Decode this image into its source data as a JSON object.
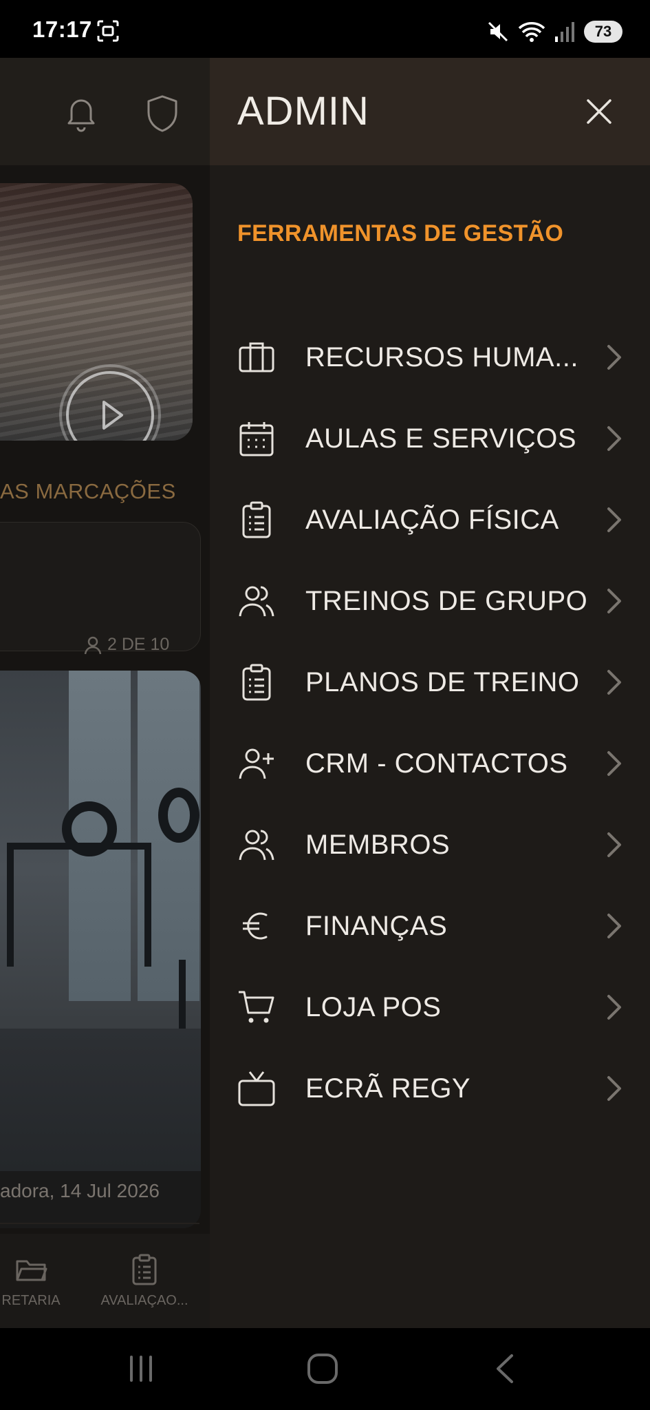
{
  "status_bar": {
    "time": "17:17",
    "battery": "73"
  },
  "background_app": {
    "section_heading": "AS MARCAÇÕES",
    "booking_count": "2 DE 10",
    "photo_caption": "adora, 14 Jul 2026",
    "tabs": [
      {
        "label": "RETARIA",
        "icon": "folder-icon"
      },
      {
        "label": "AVALIAÇAO...",
        "icon": "clipboard-icon"
      }
    ]
  },
  "drawer": {
    "title": "ADMIN",
    "section_title": "FERRAMENTAS DE GESTÃO",
    "items": [
      {
        "label": "RECURSOS HUMA...",
        "icon": "briefcase-icon"
      },
      {
        "label": "AULAS E SERVIÇOS",
        "icon": "calendar-icon"
      },
      {
        "label": "AVALIAÇÃO FÍSICA",
        "icon": "clipboard-icon"
      },
      {
        "label": "TREINOS DE GRUPO",
        "icon": "users-icon"
      },
      {
        "label": "PLANOS DE TREINO",
        "icon": "clipboard-icon"
      },
      {
        "label": "CRM - CONTACTOS",
        "icon": "user-plus-icon"
      },
      {
        "label": "MEMBROS",
        "icon": "users-icon"
      },
      {
        "label": "FINANÇAS",
        "icon": "euro-icon"
      },
      {
        "label": "LOJA POS",
        "icon": "cart-icon"
      },
      {
        "label": "ECRÃ REGY",
        "icon": "tv-icon"
      }
    ]
  },
  "colors": {
    "accent": "#f0932b",
    "drawer_bg": "#1e1b18",
    "drawer_header_bg": "#2e2620",
    "text": "#eeeae5"
  }
}
